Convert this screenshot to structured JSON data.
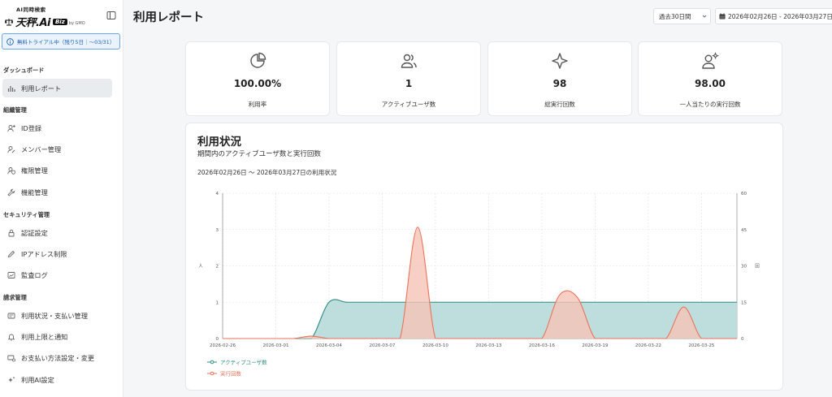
{
  "brand": {
    "tagline": "AI同時検索",
    "logo": "天秤.Ai",
    "badge": "Biz",
    "by": "by GMO"
  },
  "trial": {
    "text": "無料トライアル中（残り5日｜〜03/31）"
  },
  "sidebar": {
    "sections": [
      {
        "title": "ダッシュボード",
        "items": [
          {
            "label": "利用レポート",
            "icon": "bar-chart-icon",
            "active": true
          }
        ]
      },
      {
        "title": "組織管理",
        "items": [
          {
            "label": "ID登録",
            "icon": "user-plus-icon"
          },
          {
            "label": "メンバー管理",
            "icon": "user-edit-icon"
          },
          {
            "label": "権限管理",
            "icon": "user-shield-icon"
          },
          {
            "label": "機能管理",
            "icon": "wrench-icon"
          }
        ]
      },
      {
        "title": "セキュリティ管理",
        "items": [
          {
            "label": "認証設定",
            "icon": "lock-icon"
          },
          {
            "label": "IPアドレス制限",
            "icon": "pencil-icon"
          },
          {
            "label": "監査ログ",
            "icon": "log-icon"
          }
        ]
      },
      {
        "title": "請求管理",
        "items": [
          {
            "label": "利用状況・支払い管理",
            "icon": "receipt-icon"
          },
          {
            "label": "利用上限と通知",
            "icon": "bell-icon"
          },
          {
            "label": "お支払い方法設定・変更",
            "icon": "card-settings-icon"
          },
          {
            "label": "利用AI設定",
            "icon": "sparkle-icon"
          }
        ]
      }
    ]
  },
  "header": {
    "title": "利用レポート",
    "range": "過去30日間",
    "date_range": "2026年02月26日 - 2026年03月27日"
  },
  "stats": [
    {
      "value": "100.00%",
      "label": "利用率",
      "icon": "pie-chart-icon"
    },
    {
      "value": "1",
      "label": "アクティブユーザ数",
      "icon": "users-icon"
    },
    {
      "value": "98",
      "label": "総実行回数",
      "icon": "sparkle-icon"
    },
    {
      "value": "98.00",
      "label": "一人当たりの実行回数",
      "icon": "user-sparkle-icon"
    }
  ],
  "usage": {
    "title": "利用状況",
    "subtitle": "期間内のアクティブユーザ数と実行回数",
    "period": "2026年02月26日 〜 2026年03月27日の利用状況"
  },
  "chart_data": {
    "type": "area",
    "x_ticks": [
      "2026-02-26",
      "2026-03-01",
      "2026-03-04",
      "2026-03-07",
      "2026-03-10",
      "2026-03-13",
      "2026-03-16",
      "2026-03-19",
      "2026-03-22",
      "2026-03-25"
    ],
    "x": [
      "2026-02-26",
      "2026-02-27",
      "2026-02-28",
      "2026-03-01",
      "2026-03-02",
      "2026-03-03",
      "2026-03-04",
      "2026-03-05",
      "2026-03-06",
      "2026-03-07",
      "2026-03-08",
      "2026-03-09",
      "2026-03-10",
      "2026-03-11",
      "2026-03-12",
      "2026-03-13",
      "2026-03-14",
      "2026-03-15",
      "2026-03-16",
      "2026-03-17",
      "2026-03-18",
      "2026-03-19",
      "2026-03-20",
      "2026-03-21",
      "2026-03-22",
      "2026-03-23",
      "2026-03-24",
      "2026-03-25",
      "2026-03-26",
      "2026-03-27"
    ],
    "ylabel_left": "人",
    "ylabel_right": "回",
    "ylim_left": [
      0,
      4
    ],
    "ylim_right": [
      0,
      60
    ],
    "yticks_left": [
      0,
      1,
      2,
      3,
      4
    ],
    "yticks_right": [
      0,
      15,
      30,
      45,
      60
    ],
    "grid": true,
    "legend_position": "bottom-left",
    "series": [
      {
        "name": "アクティブユーザ数",
        "axis": "left",
        "color": "#2e8b84",
        "fill": "#b9dcdb",
        "values": [
          0,
          0,
          0,
          0,
          0,
          0,
          1,
          1,
          1,
          1,
          1,
          1,
          1,
          1,
          1,
          1,
          1,
          1,
          1,
          1,
          1,
          1,
          1,
          1,
          1,
          1,
          1,
          1,
          1,
          1
        ]
      },
      {
        "name": "実行回数",
        "axis": "right",
        "color": "#e8735a",
        "fill": "#f6c3b6",
        "values": [
          0,
          0,
          0,
          0,
          0,
          1,
          0,
          0,
          0,
          0,
          0,
          46,
          0,
          0,
          0,
          0,
          0,
          0,
          0,
          18,
          17,
          0,
          0,
          0,
          0,
          0,
          13,
          0,
          0,
          0
        ]
      }
    ]
  }
}
